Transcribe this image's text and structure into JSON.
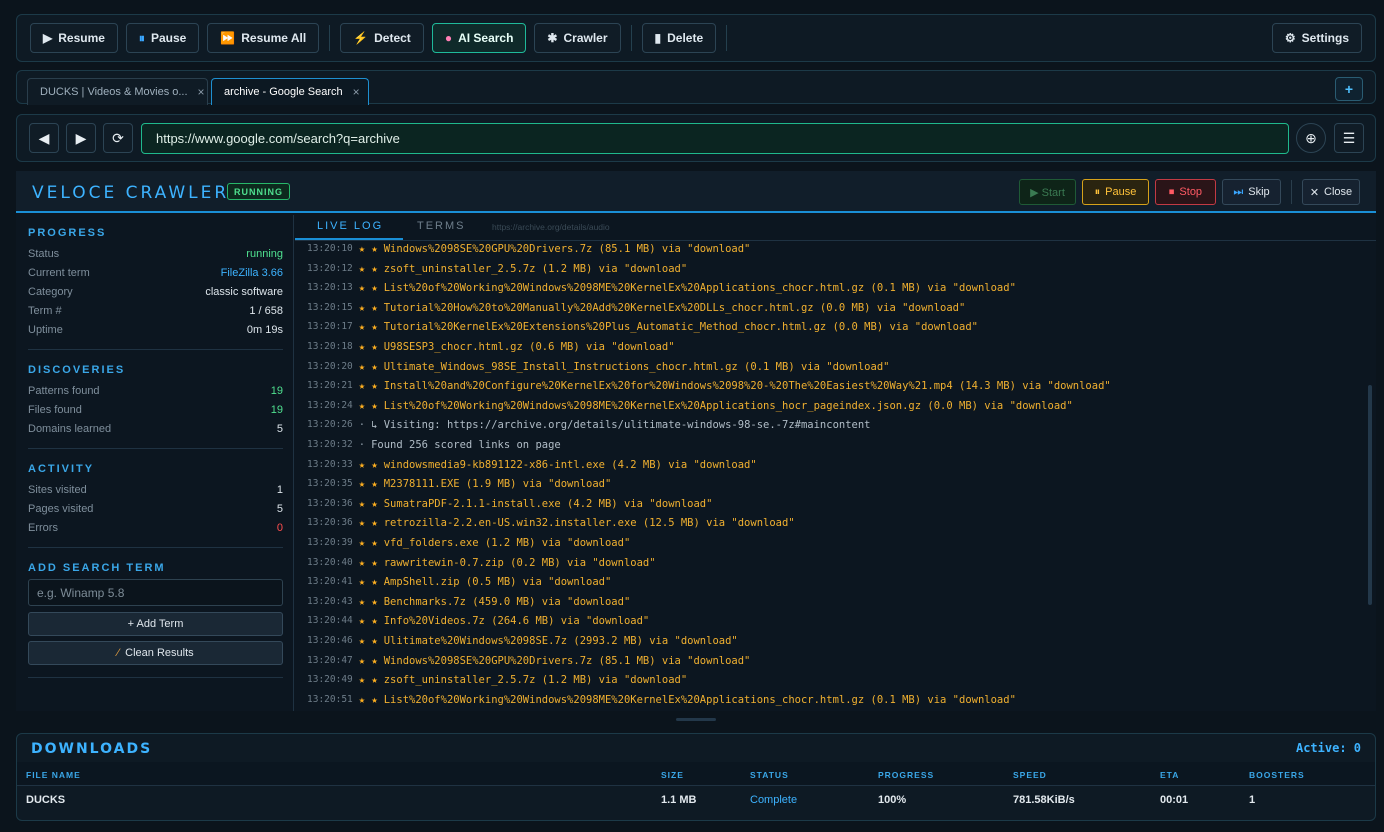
{
  "toolbar": {
    "resume": "Resume",
    "pause": "Pause",
    "resume_all": "Resume All",
    "detect": "Detect",
    "ai_search": "AI Search",
    "crawler": "Crawler",
    "delete": "Delete",
    "settings": "Settings"
  },
  "tabs": [
    {
      "label": "DUCKS | Videos & Movies o...",
      "close": "×"
    },
    {
      "label": "archive - Google Search",
      "close": "×"
    }
  ],
  "new_tab": "+",
  "nav": {
    "back": "◀",
    "forward": "▶",
    "reload": "⟳",
    "url": "https://www.google.com/search?q=archive",
    "globe": "🌐",
    "menu": "☰"
  },
  "crawler": {
    "title": "VELOCE CRAWLER",
    "status_badge": "RUNNING",
    "buttons": {
      "start": "▶ Start",
      "pause": "Pause",
      "stop": "Stop",
      "skip": "Skip",
      "close": "Close"
    },
    "progress": {
      "heading": "PROGRESS",
      "rows": [
        {
          "k": "Status",
          "v": "running"
        },
        {
          "k": "Current term",
          "v": "FileZilla 3.66"
        },
        {
          "k": "Category",
          "v": "classic software"
        },
        {
          "k": "Term #",
          "v": "1 / 658"
        },
        {
          "k": "Uptime",
          "v": "0m 19s"
        }
      ]
    },
    "discoveries": {
      "heading": "DISCOVERIES",
      "rows": [
        {
          "k": "Patterns found",
          "v": "19"
        },
        {
          "k": "Files found",
          "v": "19"
        },
        {
          "k": "Domains learned",
          "v": "5"
        }
      ]
    },
    "activity": {
      "heading": "ACTIVITY",
      "rows": [
        {
          "k": "Sites visited",
          "v": "1"
        },
        {
          "k": "Pages visited",
          "v": "5"
        },
        {
          "k": "Errors",
          "v": "0"
        }
      ]
    },
    "add_term": {
      "heading": "ADD SEARCH TERM",
      "placeholder": "e.g. Winamp 5.8",
      "add_button": "+ Add Term",
      "clean_button": "Clean Results"
    },
    "log_tabs": {
      "live": "LIVE LOG",
      "terms": "TERMS",
      "url_hint": "https://archive.org/details/audio"
    },
    "log": [
      {
        "t": "13:20:10",
        "s": "★ ★",
        "m": "Windows%2098SE%20GPU%20Drivers.7z (85.1 MB) via \"download\""
      },
      {
        "t": "13:20:12",
        "s": "★ ★",
        "m": "zsoft_uninstaller_2.5.7z (1.2 MB) via \"download\""
      },
      {
        "t": "13:20:13",
        "s": "★ ★",
        "m": "List%20of%20Working%20Windows%2098ME%20KernelEx%20Applications_chocr.html.gz (0.1 MB) via \"download\""
      },
      {
        "t": "13:20:15",
        "s": "★ ★",
        "m": "Tutorial%20How%20to%20Manually%20Add%20KernelEx%20DLLs_chocr.html.gz (0.0 MB) via \"download\""
      },
      {
        "t": "13:20:17",
        "s": "★ ★",
        "m": "Tutorial%20KernelEx%20Extensions%20Plus_Automatic_Method_chocr.html.gz (0.0 MB) via \"download\""
      },
      {
        "t": "13:20:18",
        "s": "★ ★",
        "m": "U98SESP3_chocr.html.gz (0.6 MB) via \"download\""
      },
      {
        "t": "13:20:20",
        "s": "★ ★",
        "m": "Ultimate_Windows_98SE_Install_Instructions_chocr.html.gz (0.1 MB) via \"download\""
      },
      {
        "t": "13:20:21",
        "s": "★ ★",
        "m": "Install%20and%20Configure%20KernelEx%20for%20Windows%2098%20-%20The%20Easiest%20Way%21.mp4 (14.3 MB) via \"download\""
      },
      {
        "t": "13:20:24",
        "s": "★ ★",
        "m": "List%20of%20Working%20Windows%2098ME%20KernelEx%20Applications_hocr_pageindex.json.gz (0.0 MB) via \"download\""
      },
      {
        "t": "13:20:26",
        "s": "·",
        "m": "↳ Visiting: https://archive.org/details/ulitimate-windows-98-se.-7z#maincontent",
        "muted": true
      },
      {
        "t": "13:20:32",
        "s": "·",
        "m": "Found 256 scored links on page",
        "muted": true
      },
      {
        "t": "13:20:33",
        "s": "★ ★",
        "m": "windowsmedia9-kb891122-x86-intl.exe (4.2 MB) via \"download\""
      },
      {
        "t": "13:20:35",
        "s": "★ ★",
        "m": "M2378111.EXE (1.9 MB) via \"download\""
      },
      {
        "t": "13:20:36",
        "s": "★ ★",
        "m": "SumatraPDF-2.1.1-install.exe (4.2 MB) via \"download\""
      },
      {
        "t": "13:20:36",
        "s": "★ ★",
        "m": "retrozilla-2.2.en-US.win32.installer.exe (12.5 MB) via \"download\""
      },
      {
        "t": "13:20:39",
        "s": "★ ★",
        "m": "vfd_folders.exe (1.2 MB) via \"download\""
      },
      {
        "t": "13:20:40",
        "s": "★ ★",
        "m": "rawwritewin-0.7.zip (0.2 MB) via \"download\""
      },
      {
        "t": "13:20:41",
        "s": "★ ★",
        "m": "AmpShell.zip (0.5 MB) via \"download\""
      },
      {
        "t": "13:20:43",
        "s": "★ ★",
        "m": "Benchmarks.7z (459.0 MB) via \"download\""
      },
      {
        "t": "13:20:44",
        "s": "★ ★",
        "m": "Info%20Videos.7z (264.6 MB) via \"download\""
      },
      {
        "t": "13:20:46",
        "s": "★ ★",
        "m": "Ulitimate%20Windows%2098SE.7z (2993.2 MB) via \"download\""
      },
      {
        "t": "13:20:47",
        "s": "★ ★",
        "m": "Windows%2098SE%20GPU%20Drivers.7z (85.1 MB) via \"download\""
      },
      {
        "t": "13:20:49",
        "s": "★ ★",
        "m": "zsoft_uninstaller_2.5.7z (1.2 MB) via \"download\""
      },
      {
        "t": "13:20:51",
        "s": "★ ★",
        "m": "List%20of%20Working%20Windows%2098ME%20KernelEx%20Applications_chocr.html.gz (0.1 MB) via \"download\""
      }
    ]
  },
  "downloads": {
    "title": "DOWNLOADS",
    "active": "Active: 0",
    "headers": [
      "FILE NAME",
      "SIZE",
      "STATUS",
      "PROGRESS",
      "SPEED",
      "ETA",
      "BOOSTERS"
    ],
    "rows": [
      [
        "DUCKS",
        "1.1 MB",
        "Complete",
        "100%",
        "781.58KiB/s",
        "00:01",
        "1"
      ]
    ]
  },
  "colors": {
    "accent": "#3db3ff",
    "success": "#4fe08f",
    "log_text": "#f0b030",
    "error": "#ff4d4d"
  }
}
